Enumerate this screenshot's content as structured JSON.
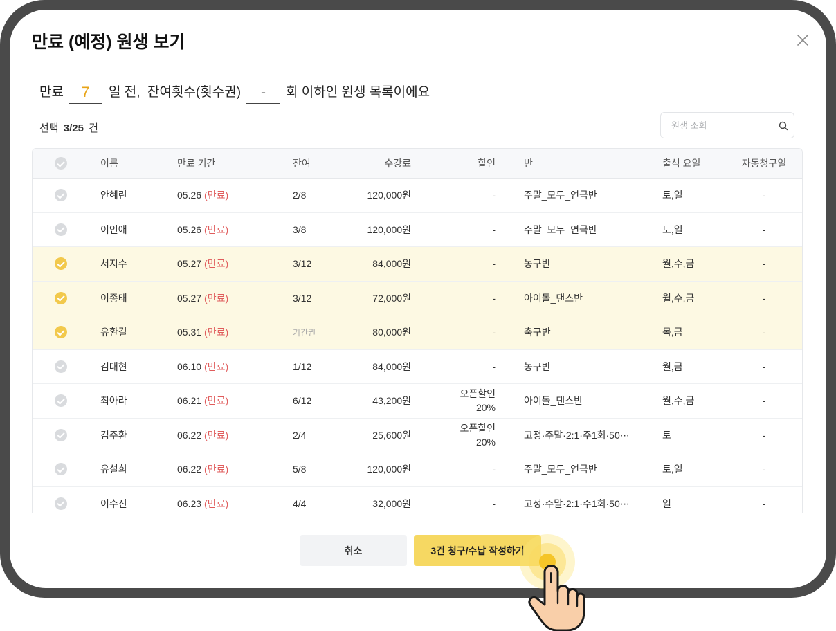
{
  "dialog": {
    "title": "만료 (예정) 원생 보기",
    "close_icon": "close-icon"
  },
  "filter": {
    "prefix": "만료",
    "days_value": "7",
    "days_suffix": "일 전,",
    "remaining_label": "잔여횟수(횟수권)",
    "remaining_value": "-",
    "suffix": "회 이하인 원생 목록이에요"
  },
  "selection": {
    "label": "선택",
    "count": "3/25",
    "unit": "건"
  },
  "search": {
    "placeholder": "원생 조회",
    "icon": "search-icon"
  },
  "table": {
    "headers": {
      "name": "이름",
      "expiry": "만료 기간",
      "remaining": "잔여",
      "fee": "수강료",
      "discount": "할인",
      "class": "반",
      "days": "출석 요일",
      "auto_billing": "자동청구일"
    },
    "rows": [
      {
        "name": "안혜린",
        "expiry_date": "05.26",
        "expiry_status": "(만료)",
        "remaining": "2/8",
        "fee": "120,000원",
        "discount": "-",
        "class": "주말_모두_연극반",
        "days": "토,일",
        "auto_billing": "-",
        "selected": false
      },
      {
        "name": "이인애",
        "expiry_date": "05.26",
        "expiry_status": "(만료)",
        "remaining": "3/8",
        "fee": "120,000원",
        "discount": "-",
        "class": "주말_모두_연극반",
        "days": "토,일",
        "auto_billing": "-",
        "selected": false
      },
      {
        "name": "서지수",
        "expiry_date": "05.27",
        "expiry_status": "(만료)",
        "remaining": "3/12",
        "fee": "84,000원",
        "discount": "-",
        "class": "농구반",
        "days": "월,수,금",
        "auto_billing": "-",
        "selected": true
      },
      {
        "name": "이종태",
        "expiry_date": "05.27",
        "expiry_status": "(만료)",
        "remaining": "3/12",
        "fee": "72,000원",
        "discount": "-",
        "class": "아이돌_댄스반",
        "days": "월,수,금",
        "auto_billing": "-",
        "selected": true
      },
      {
        "name": "유환길",
        "expiry_date": "05.31",
        "expiry_status": "(만료)",
        "remaining": "기간권",
        "fee": "80,000원",
        "discount": "-",
        "class": "축구반",
        "days": "목,금",
        "auto_billing": "-",
        "selected": true
      },
      {
        "name": "김대현",
        "expiry_date": "06.10",
        "expiry_status": "(만료)",
        "remaining": "1/12",
        "fee": "84,000원",
        "discount": "-",
        "class": "농구반",
        "days": "월,금",
        "auto_billing": "-",
        "selected": false
      },
      {
        "name": "최아라",
        "expiry_date": "06.21",
        "expiry_status": "(만료)",
        "remaining": "6/12",
        "fee": "43,200원",
        "discount": "오픈할인",
        "discount_rate": "20%",
        "class": "아이돌_댄스반",
        "days": "월,수,금",
        "auto_billing": "-",
        "selected": false
      },
      {
        "name": "김주환",
        "expiry_date": "06.22",
        "expiry_status": "(만료)",
        "remaining": "2/4",
        "fee": "25,600원",
        "discount": "오픈할인",
        "discount_rate": "20%",
        "class": "고정·주말·2:1·주1회·50⋯",
        "days": "토",
        "auto_billing": "-",
        "selected": false
      },
      {
        "name": "유설희",
        "expiry_date": "06.22",
        "expiry_status": "(만료)",
        "remaining": "5/8",
        "fee": "120,000원",
        "discount": "-",
        "class": "주말_모두_연극반",
        "days": "토,일",
        "auto_billing": "-",
        "selected": false
      },
      {
        "name": "이수진",
        "expiry_date": "06.23",
        "expiry_status": "(만료)",
        "remaining": "4/4",
        "fee": "32,000원",
        "discount": "-",
        "class": "고정·주말·2:1·주1회·50⋯",
        "days": "일",
        "auto_billing": "-",
        "selected": false
      }
    ]
  },
  "footer": {
    "cancel_label": "취소",
    "submit_label": "3건 청구/수납 작성하기"
  },
  "pointer": {
    "icon": "pointer-hand-icon"
  },
  "colors": {
    "accent": "#f6d862",
    "selected_row": "#fdf9e3",
    "check_selected": "#f2c94c",
    "expired": "#e05c5c",
    "filter_value": "#e8a417",
    "frame": "#4a4a4a"
  }
}
